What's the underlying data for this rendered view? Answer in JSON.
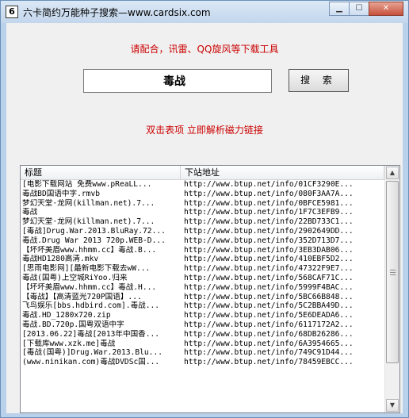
{
  "window": {
    "icon_glyph": "6",
    "title": "六卡简约万能种子搜索—www.cardsix.com",
    "minimize_glyph": "▁",
    "maximize_glyph": "☐",
    "close_glyph": "✕"
  },
  "notice": "请配合，讯雷、QQ旋风等下载工具",
  "search": {
    "value": "毒战",
    "button_label": "搜 索"
  },
  "hint": "双击表项 立即解析磁力链接",
  "table": {
    "columns": [
      "标题",
      "下站地址"
    ],
    "rows": [
      [
        "[电影下载网站 免费www.pReaLL...",
        "http://www.btup.net/info/01CF3290E..."
      ],
      [
        "毒战BD国语中字.rmvb",
        "http://www.btup.net/info/080F3AA7A..."
      ],
      [
        "梦幻天堂·龙网(killman.net).7...",
        "http://www.btup.net/info/0BFCE5981..."
      ],
      [
        "毒战",
        "http://www.btup.net/info/1F7C3EFB9..."
      ],
      [
        "梦幻天堂·龙网(killman.net).7...",
        "http://www.btup.net/info/22BD733C1..."
      ],
      [
        "[毒战]Drug.War.2013.BluRay.72...",
        "http://www.btup.net/info/2902649DD..."
      ],
      [
        "毒战.Drug War 2013 720p.WEB-D...",
        "http://www.btup.net/info/352D713D7..."
      ],
      [
        "【坏坏美眉www.hhmm.cc】毒战.B...",
        "http://www.btup.net/info/3EB3DAB06..."
      ],
      [
        "毒战HD1280高清.mkv",
        "http://www.btup.net/info/410EBF5D2..."
      ],
      [
        "[思雨电影网][最新电影下载去wW...",
        "http://www.btup.net/info/47322F9E7..."
      ],
      [
        "毒战(国粤)上空城RiYoo.归来",
        "http://www.btup.net/info/568CAF71C..."
      ],
      [
        "【坏坏美眉www.hhmm.cc】毒战.H...",
        "http://www.btup.net/info/5999F4BAC..."
      ],
      [
        "【毒战】【高清蓝光720P国语】...",
        "http://www.btup.net/info/5BC66B848..."
      ],
      [
        "飞鸟娱乐[bbs.hdbird.com].毒战...",
        "http://www.btup.net/info/5C2BBA49D..."
      ],
      [
        "毒战.HD_1280x720.zip",
        "http://www.btup.net/info/5E6DEADA6..."
      ],
      [
        "毒战.BD.720p.国粤双语中字",
        "http://www.btup.net/info/6117172A2..."
      ],
      [
        "[2013.06.22]毒战[2013年中国香...",
        "http://www.btup.net/info/68DB26286..."
      ],
      [
        "[下载库www.xzk.me]毒战",
        "http://www.btup.net/info/6A3954665..."
      ],
      [
        "[毒战(国粤)]Drug.War.2013.Blu...",
        "http://www.btup.net/info/749C91D44..."
      ],
      [
        "(www.ninikan.com)毒战DVDSc国...",
        "http://www.btup.net/info/78459EBCC..."
      ]
    ]
  },
  "scrollbar": {
    "up_glyph": "▲",
    "down_glyph": "▼",
    "thumb_position": 0.0
  }
}
